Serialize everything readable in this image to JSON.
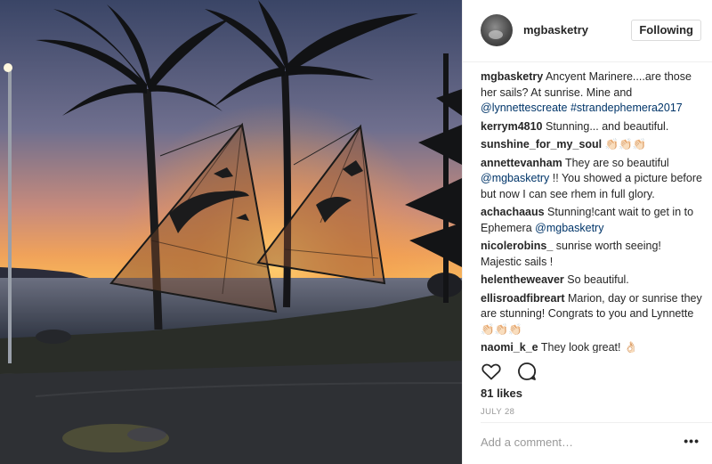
{
  "post": {
    "username": "mgbasketry",
    "follow_label": "Following"
  },
  "caption": {
    "username": "mgbasketry",
    "text_1": " Ancyent Marinere....are those her sails? At sunrise. Mine and ",
    "mention": "@lynnettescreate",
    "text_2": " ",
    "hashtag": "#strandephemera2017"
  },
  "comments": [
    {
      "user": "kerrym4810",
      "text": " Stunning... and beautiful.",
      "mention": "",
      "tail": ""
    },
    {
      "user": "sunshine_for_my_soul",
      "text": " 👏🏻👏🏻👏🏻",
      "mention": "",
      "tail": ""
    },
    {
      "user": "annettevanham",
      "text": " They are so beautiful ",
      "mention": "@mgbasketry",
      "tail": " !! You showed a picture before but now I can see rhem in full glory."
    },
    {
      "user": "achachaaus",
      "text": " Stunning!cant wait to get in to Ephemera ",
      "mention": "@mgbasketry",
      "tail": ""
    },
    {
      "user": "nicolerobins_",
      "text": " sunrise worth seeing! Majestic sails !",
      "mention": "",
      "tail": ""
    },
    {
      "user": "helentheweaver",
      "text": " So beautiful.",
      "mention": "",
      "tail": ""
    },
    {
      "user": "ellisroadfibreart",
      "text": " Marion, day or sunrise they are stunning! Congrats to you and Lynnette 👏🏻👏🏻👏🏻",
      "mention": "",
      "tail": ""
    },
    {
      "user": "naomi_k_e",
      "text": " They look great! 👌🏻",
      "mention": "",
      "tail": ""
    }
  ],
  "likes": "81 likes",
  "date": "JULY 28",
  "add_comment_placeholder": "Add a comment…",
  "more_label": "•••",
  "icons": {
    "like": "heart-icon",
    "comment": "comment-bubble-icon",
    "more": "more-options-icon"
  },
  "colors": {
    "mention": "#003569",
    "text": "#262626",
    "muted": "#999999"
  }
}
